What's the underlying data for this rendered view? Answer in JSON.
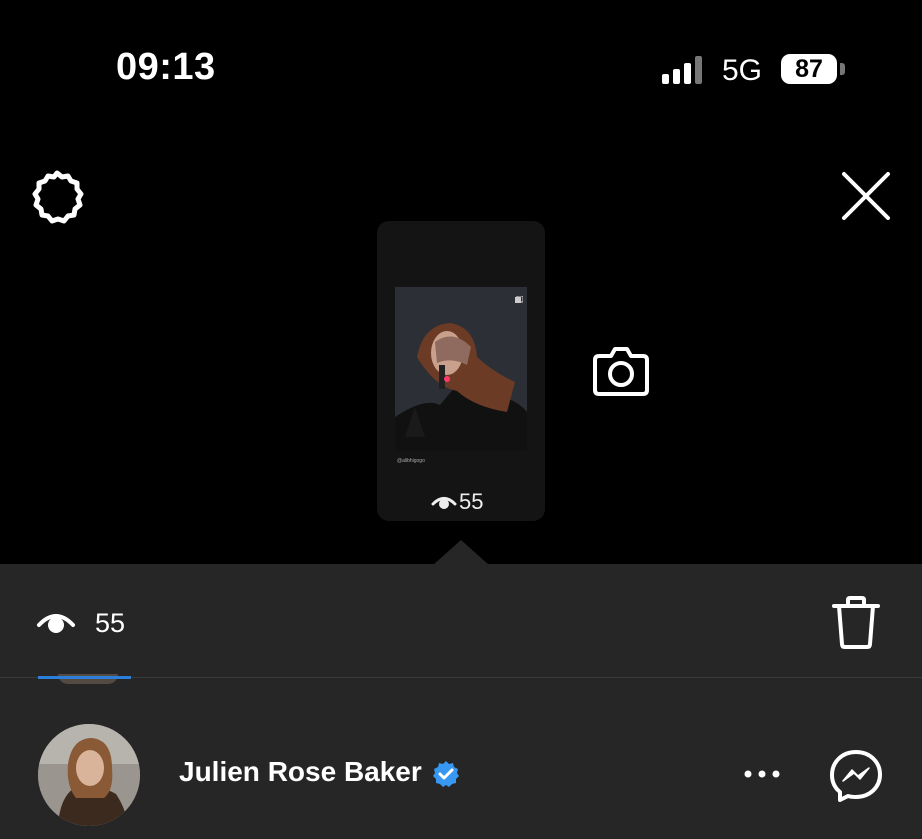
{
  "status_bar": {
    "time": "09:13",
    "network": "5G",
    "battery": "87"
  },
  "story": {
    "caption": "@alibhigogo",
    "view_count": "55"
  },
  "viewers_panel": {
    "view_count": "55",
    "viewers": [
      {
        "name": "Julien Rose Baker",
        "verified": true
      }
    ]
  },
  "icons": {
    "settings": "gear-icon",
    "close": "close-icon",
    "camera": "camera-icon",
    "views": "eye-icon",
    "delete": "trash-icon",
    "more": "more-icon",
    "message": "messenger-icon"
  },
  "colors": {
    "background": "#000000",
    "panel": "#262626",
    "accent": "#2b7fd9",
    "verified": "#3897f0"
  }
}
